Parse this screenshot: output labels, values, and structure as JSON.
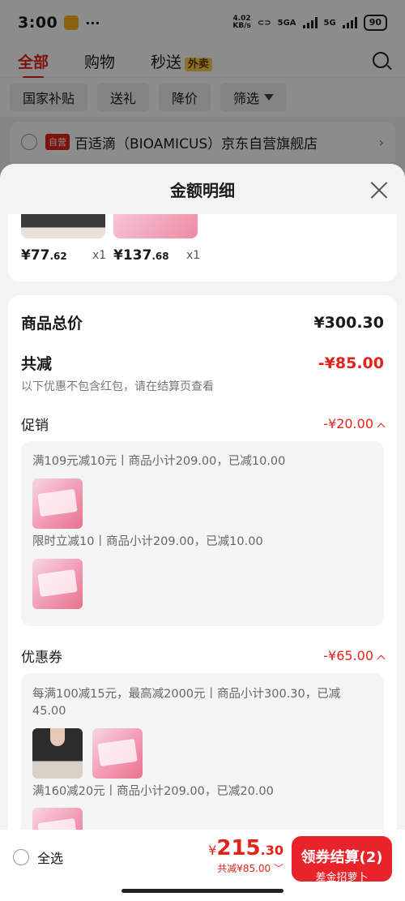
{
  "status": {
    "time": "3:00",
    "dots": "···",
    "speed_top": "4.02",
    "speed_bottom": "KB/s",
    "net1": "5GA",
    "net2": "5G",
    "battery": "90"
  },
  "tabs": [
    {
      "label": "全部"
    },
    {
      "label": "购物"
    },
    {
      "label": "秒送"
    }
  ],
  "tab_badge": "外卖",
  "filters": [
    "国家补贴",
    "送礼",
    "降价",
    "筛选"
  ],
  "shop": {
    "tag": "自营",
    "name": "百适滴（BIOAMICUS）京东自营旗舰店"
  },
  "sheet": {
    "title": "金额明细",
    "goods": [
      {
        "price_int": "¥77",
        "price_dec": ".62",
        "qty": "x1"
      },
      {
        "price_int": "¥137",
        "price_dec": ".68",
        "qty": "x1"
      }
    ],
    "total_label": "商品总价",
    "total_value": "¥300.30",
    "reduce_label": "共减",
    "reduce_value": "-¥85.00",
    "reduce_note": "以下优惠不包含红包，请在结算页查看",
    "promo": {
      "label": "促销",
      "value": "-¥20.00",
      "items": [
        "满109元减10元丨商品小计209.00，已减10.00",
        "限时立减10丨商品小计209.00，已减10.00"
      ]
    },
    "coupon": {
      "label": "优惠券",
      "value": "-¥65.00",
      "items": [
        "每满100减15元，最高减2000元丨商品小计300.30，已减45.00",
        "满160减20元丨商品小计209.00，已减20.00"
      ]
    }
  },
  "bottom": {
    "select_all": "全选",
    "yen": "¥",
    "total_int": "215",
    "total_dec": ".30",
    "reduced": "共减¥85.00 ﹀",
    "checkout": "领券结算(2)",
    "checkout_sub": "差金招萝卜"
  },
  "colors": {
    "accent": "#e2231a",
    "badge": "#f7d14a"
  }
}
